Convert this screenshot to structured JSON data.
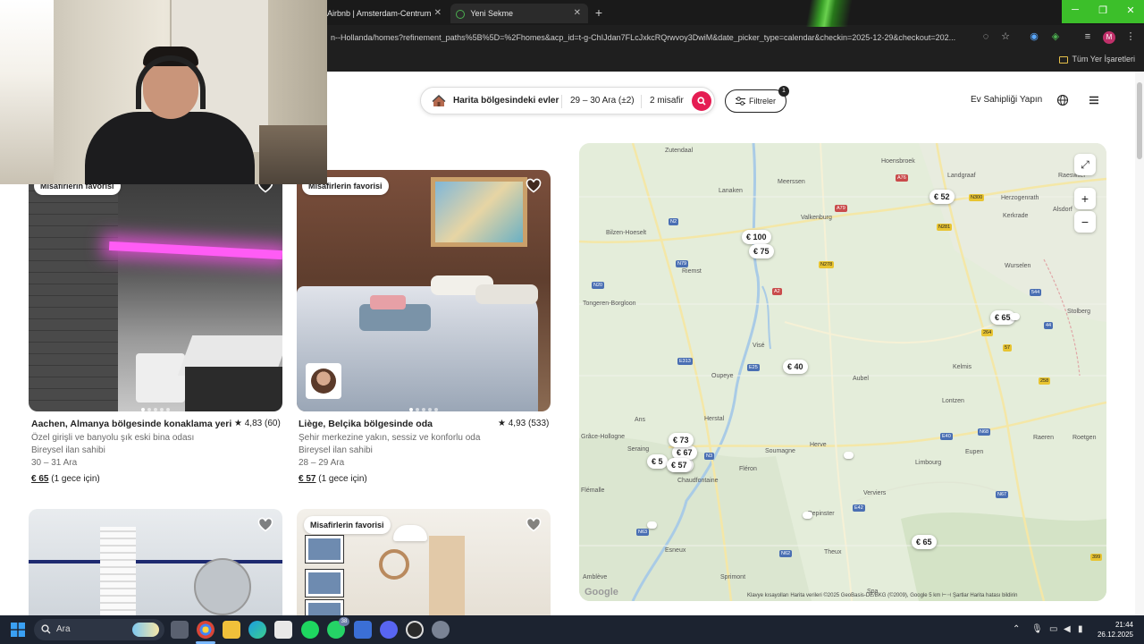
{
  "browser": {
    "tabs": [
      {
        "label": "Airbnb | Amsterdam-Centrum"
      },
      {
        "label": "Yeni Sekme"
      }
    ],
    "url": "n--Hollanda/homes?refinement_paths%5B%5D=%2Fhomes&acp_id=t-g-ChIJdan7FLcJxkcRQrwvoy3DwiM&date_picker_type=calendar&checkin=2025-12-29&checkout=202...",
    "bookmarks_all": "Tüm Yer İşaretleri",
    "profile_initial": "M"
  },
  "header": {
    "search_where": "Harita bölgesindeki evler",
    "search_dates": "29 – 30 Ara (±2)",
    "search_guests": "2 misafir",
    "filters_label": "Filtreler",
    "filters_count": "1",
    "host_label": "Ev Sahipliği Yapın"
  },
  "listings": [
    {
      "badge": "Misafirlerin favorisi",
      "title": "Aachen, Almanya bölgesinde konaklama yeri",
      "rating": "★ 4,83 (60)",
      "subtitle": "Özel girişli ve banyolu şık eski bina odası",
      "host": "Bireysel ilan sahibi",
      "dates": "30 – 31 Ara",
      "price": "€ 65",
      "price_note": "(1 gece için)"
    },
    {
      "badge": "Misafirlerin favorisi",
      "title": "Liège, Belçika bölgesinde oda",
      "rating": "★ 4,93 (533)",
      "subtitle": "Şehir merkezine yakın, sessiz ve konforlu oda",
      "host": "Bireysel ilan sahibi",
      "dates": "28 – 29 Ara",
      "price": "€ 57",
      "price_note": "(1 gece için)"
    },
    {
      "badge": ""
    },
    {
      "badge": "Misafirlerin favorisi"
    }
  ],
  "map": {
    "pins": [
      "€ 52",
      "€ 100",
      "€ 75",
      "€ 65",
      "€ 40",
      "€ 73",
      "€ 5?",
      "€ 57",
      "€ 65"
    ],
    "pin_partial_1": "€ 5",
    "pin_partial_2": "€ 67",
    "cities": [
      "Zutendaal",
      "Lanaken",
      "Meerssen",
      "Hoensbroek",
      "Landgraaf",
      "Herzogenrath",
      "Kerkrade",
      "Valkenburg",
      "Alsdorf",
      "Raeswiler",
      "Bilzen-Hoeselt",
      "Riemst",
      "Wurselen",
      "Tongeren-Borgloon",
      "Stolberg",
      "Visé",
      "Oupeye",
      "Aubel",
      "Kelmis",
      "Lontzen",
      "Herstal",
      "Ans",
      "Grâce-Hollogne",
      "Soumagne",
      "Herve",
      "Raeren",
      "Eupen",
      "Seraing",
      "Fléron",
      "Limbourg",
      "Chaudfontaine",
      "Flémalle",
      "Verviers",
      "Roetgen",
      "Pepinster",
      "Esneux",
      "Theux",
      "Sprimont",
      "Amblève",
      "Spa"
    ],
    "roads": [
      {
        "label": "N2",
        "kind": "n"
      },
      {
        "label": "N79",
        "kind": "n"
      },
      {
        "label": "N20",
        "kind": "n"
      },
      {
        "label": "A2",
        "kind": "a"
      },
      {
        "label": "A76",
        "kind": "a"
      },
      {
        "label": "A79",
        "kind": "a"
      },
      {
        "label": "N278",
        "kind": "y"
      },
      {
        "label": "N300",
        "kind": "y"
      },
      {
        "label": "E25",
        "kind": "n"
      },
      {
        "label": "E313",
        "kind": "n"
      },
      {
        "label": "N3",
        "kind": "n"
      },
      {
        "label": "E42",
        "kind": "n"
      },
      {
        "label": "E40",
        "kind": "n"
      },
      {
        "label": "N68",
        "kind": "n"
      },
      {
        "label": "N67",
        "kind": "n"
      },
      {
        "label": "N62",
        "kind": "n"
      },
      {
        "label": "N63",
        "kind": "n"
      },
      {
        "label": "544",
        "kind": "n"
      },
      {
        "label": "44",
        "kind": "n"
      },
      {
        "label": "57",
        "kind": "y"
      },
      {
        "label": "264",
        "kind": "y"
      },
      {
        "label": "258",
        "kind": "y"
      },
      {
        "label": "N281",
        "kind": "y"
      },
      {
        "label": "399",
        "kind": "y"
      }
    ],
    "footer": "Klavye kısayolları    Harita verileri ©2025 GeoBasis-DE/BKG (©2009), Google    5 km ⊢⊣    Şartlar    Harita hatası bildirin",
    "google": "Google",
    "fullscreen_icon": "expand-icon",
    "zoom_in": "+",
    "zoom_out": "−"
  },
  "taskbar": {
    "search_label": "Ara",
    "whatsapp_badge": "38",
    "time": "21:44",
    "date": "26.12.2025"
  },
  "colors": {
    "airbnb_accent": "#e51d53",
    "taskbar_bg": "#1c2330",
    "map_bg": "#e5eedb",
    "chrome_bg": "#1f1f1f"
  }
}
